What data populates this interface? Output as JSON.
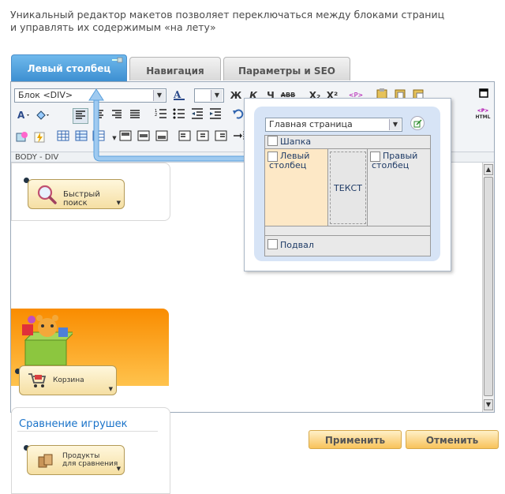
{
  "intro": {
    "line1": "Уникальный редактор макетов позволяет переключаться между блоками страниц",
    "line2": "и управлять их содержимым «на лету»"
  },
  "tabs": [
    {
      "label": "Левый столбец",
      "active": true
    },
    {
      "label": "Навигация",
      "active": false
    },
    {
      "label": "Параметры и SEO",
      "active": false
    }
  ],
  "toolbar": {
    "block_select": "Блок <DIV>",
    "bold": "Ж",
    "italic": "К",
    "underline": "Ч",
    "strike": "ABB",
    "subscript": "X₂",
    "superscript": "X²",
    "paragraph": "<P>",
    "html_label": "HTML",
    "html_tag": "<P>"
  },
  "pathbar": "BODY - DIV",
  "canvas": {
    "quick_search": "Быстрый поиск",
    "cart": "Корзина",
    "compare_title": "Сравнение игрушек",
    "compare_button_line1": "Продукты",
    "compare_button_line2": "для сравнения"
  },
  "popover": {
    "page_select": "Главная страница",
    "header": "Шапка",
    "left_col_line1": "Левый",
    "left_col_line2": "столбец",
    "content": "ТЕКСТ",
    "right_col_line1": "Правый",
    "right_col_line2": "столбец",
    "footer": "Подвал"
  },
  "buttons": {
    "apply": "Применить",
    "cancel": "Отменить"
  },
  "colors": {
    "tab_active": "#4a9ae0",
    "accent_orange": "#f98c00",
    "popover_bg": "#d7e4f6",
    "left_col_highlight": "#fde8c6",
    "compare_title": "#1a73c9"
  }
}
